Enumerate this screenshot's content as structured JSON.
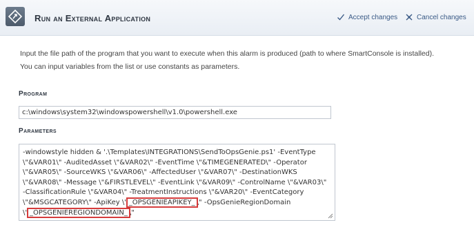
{
  "header": {
    "title": "Run an External Application",
    "accept_label": "Accept changes",
    "cancel_label": "Cancel changes"
  },
  "description": {
    "line1": "Input the file path of the program that you want to execute when this alarm is produced (path to where SmartConsole is installed).",
    "line2": "You can input variables from the list or use constants as parameters."
  },
  "program": {
    "label": "Program",
    "value": "c:\\windows\\system32\\windowspowershell\\v1.0\\powershell.exe"
  },
  "parameters": {
    "label": "Parameters",
    "text_before": "-windowstyle hidden & '.\\Templates\\INTEGRATIONS\\SendToOpsGenie.ps1' -EventType \\\"&VAR01\\\" -AuditedAsset \\\"&VAR02\\\" -EventTime \\\"&TIMEGENERATED\\\" -Operator \\\"&VAR05\\\" -SourceWKS \\\"&VAR06\\\" -AffectedUser \\\"&VAR07\\\" -DestinationWKS \\\"&VAR08\\\" -Message \\\"&FIRSTLEVEL\\\" -EventLink \\\"&VAR09\\\" -ControlName \\\"&VAR03\\\" -ClassificationRule \\\"&VAR04\\\" -TreatmentInstructions \\\"&VAR20\\\" -EventCategory \\\"&MSGCATEGORY\\\" -ApiKey \\\"",
    "highlight1": "_OPSGENIEAPIKEY_",
    "text_middle": "\\\" -OpsGenieRegionDomain \\\"",
    "highlight2": "_OPSGENIEREGIONDOMAIN_",
    "text_after": "\\\""
  },
  "colors": {
    "highlight_border": "#d53b3b",
    "link": "#3a5a86"
  },
  "icons": [
    "app-icon",
    "checkmark-icon",
    "cancel-icon",
    "resize-handle-icon"
  ]
}
